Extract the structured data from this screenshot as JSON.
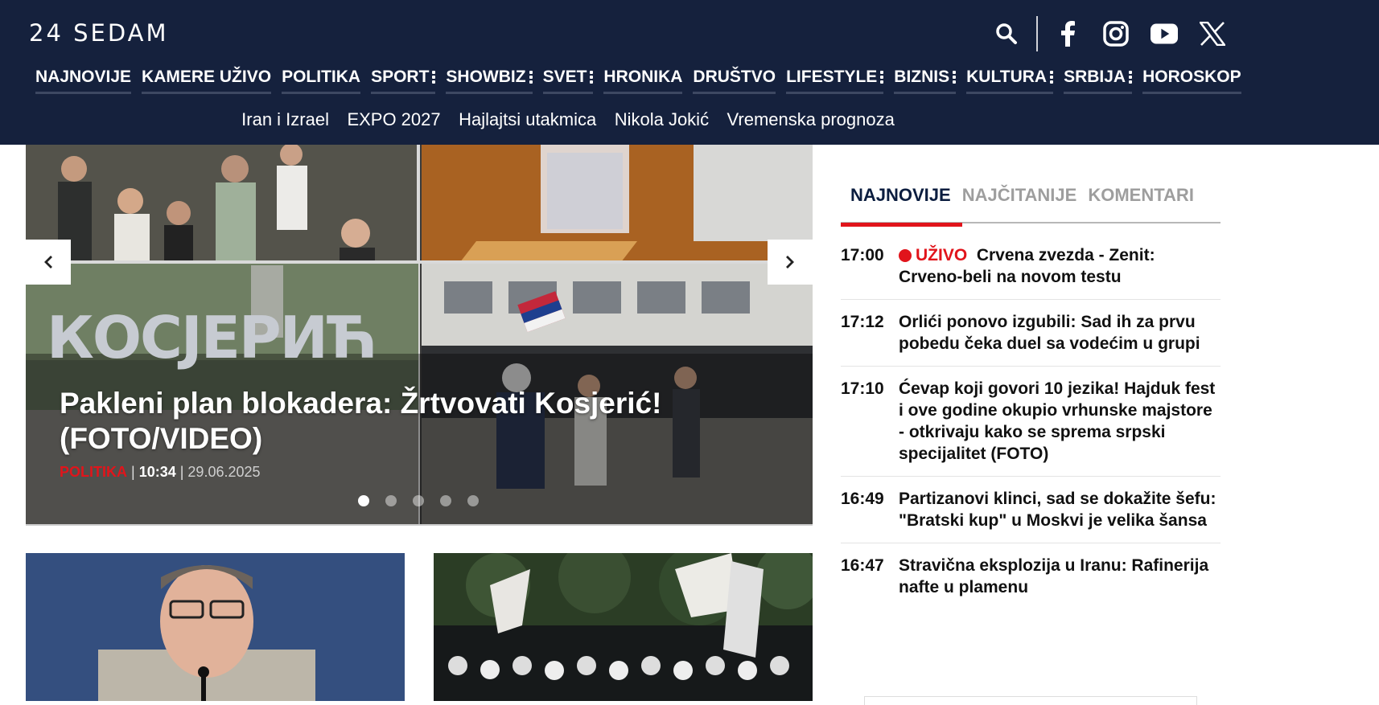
{
  "header": {
    "logo": "24 SEDAM",
    "tool_icons": [
      "search-icon",
      "facebook-icon",
      "instagram-icon",
      "youtube-icon",
      "x-icon"
    ]
  },
  "main_nav": [
    {
      "label": "NAJNOVIJE",
      "has_submenu": false
    },
    {
      "label": "KAMERE UŽIVO",
      "has_submenu": false
    },
    {
      "label": "POLITIKA",
      "has_submenu": false
    },
    {
      "label": "SPORT",
      "has_submenu": true
    },
    {
      "label": "SHOWBIZ",
      "has_submenu": true
    },
    {
      "label": "SVET",
      "has_submenu": true
    },
    {
      "label": "HRONIKA",
      "has_submenu": false
    },
    {
      "label": "DRUŠTVO",
      "has_submenu": false
    },
    {
      "label": "LIFESTYLE",
      "has_submenu": true
    },
    {
      "label": "BIZNIS",
      "has_submenu": true
    },
    {
      "label": "KULTURA",
      "has_submenu": true
    },
    {
      "label": "SRBIJA",
      "has_submenu": true
    },
    {
      "label": "HOROSKOP",
      "has_submenu": false
    }
  ],
  "sub_nav": [
    "Iran i Izrael",
    "EXPO 2027",
    "Hajlajtsi utakmica",
    "Nikola Jokić",
    "Vremenska prognoza"
  ],
  "hero": {
    "title": "Pakleni plan blokadera: Žrtvovati Kosjerić! (FOTO/VIDEO)",
    "category": "POLITIKA",
    "time": "10:34",
    "date": "29.06.2025",
    "sign_text": "КОСЈЕРИЋ",
    "slide_count": 5,
    "active_slide": 1
  },
  "sidebar": {
    "tabs": [
      "NAJNOVIJE",
      "NAJČITANIJE",
      "KOMENTARI"
    ],
    "active_tab": "NAJNOVIJE",
    "live_label": "UŽIVO",
    "news": [
      {
        "time": "17:00",
        "live": true,
        "text": "Crvena zvezda - Zenit: Crveno-beli na novom testu"
      },
      {
        "time": "17:12",
        "live": false,
        "text": "Orlići ponovo izgubili: Sad ih za prvu pobedu čeka duel sa vodećim u grupi"
      },
      {
        "time": "17:10",
        "live": false,
        "text": "Ćevap koji govori 10 jezika! Hajduk fest i ove godine okupio vrhunske majstore - otkrivaju kako se sprema srpski specijalitet (FOTO)"
      },
      {
        "time": "16:49",
        "live": false,
        "text": "Partizanovi klinci, sad se dokažite šefu: \"Bratski kup\" u Moskvi je velika šansa"
      },
      {
        "time": "16:47",
        "live": false,
        "text": "Stravična eksplozija u Iranu: Rafinerija nafte u plamenu"
      }
    ]
  },
  "colors": {
    "header_bg": "#15213d",
    "accent": "#e1141b"
  }
}
